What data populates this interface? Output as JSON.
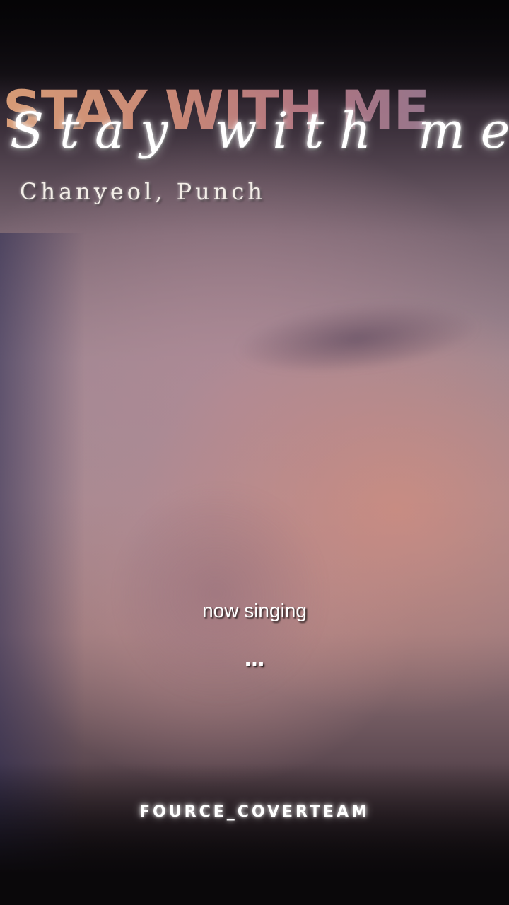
{
  "title": {
    "block_text": "STAY WITH ME",
    "script_text": "Stay with me",
    "artists": "Chanyeol, Punch"
  },
  "caption": {
    "status": "now singing",
    "ellipsis": "..."
  },
  "watermark": "FOURCE_COVERTEAM",
  "colors": {
    "title_gradient_start": "#e0a27a",
    "title_gradient_end": "#8a7a98",
    "text": "#ffffff"
  }
}
